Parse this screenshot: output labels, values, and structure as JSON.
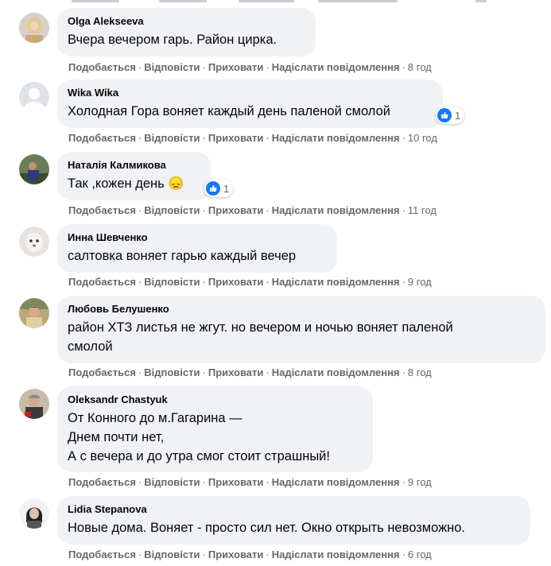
{
  "actions": {
    "like": "Подобається",
    "reply": "Відповісти",
    "hide": "Приховати",
    "message": "Надіслати повідомлення",
    "sep": "·"
  },
  "colors": {
    "bubble": "#f0f2f5",
    "action_text": "#65676b",
    "like_blue": "#1877f2"
  },
  "comments": [
    {
      "author": "Olga Alekseeva",
      "text": "Вчера вечером гарь. Район цирка.",
      "time": "8 год",
      "avatar": "photo-avatar"
    },
    {
      "author": "Wika Wika",
      "text": "Холодная Гора воняет каждый день паленой смолой",
      "time": "10 год",
      "avatar": "default-avatar",
      "reaction_count": "1",
      "reaction_icon": "like-icon"
    },
    {
      "author": "Наталія Калмикова",
      "text": "Так ,кожен день",
      "emoji": "😞",
      "time": "11 год",
      "avatar": "photo-avatar",
      "reaction_count": "1",
      "reaction_icon": "like-icon"
    },
    {
      "author": "Инна Шевченко",
      "text": "салтовка воняет гарью каждый вечер",
      "time": "9 год",
      "avatar": "photo-avatar"
    },
    {
      "author": "Любовь Белушенко",
      "text_lines": [
        "район ХТЗ листья не жгут. но вечером и ночью воняет паленой",
        "смолой"
      ],
      "time": "8 год",
      "avatar": "photo-avatar"
    },
    {
      "author": "Oleksandr Chastyuk",
      "text_lines": [
        "От Конного до м.Гагарина —",
        "Днем почти нет,",
        "А с вечера и до утра смог стоит страшный!"
      ],
      "time": "9 год",
      "avatar": "photo-avatar"
    },
    {
      "author": "Lidia Stepanova",
      "text": "Новые дома. Воняет - просто сил нет. Окно открыть невозможно.",
      "time": "6 год",
      "avatar": "photo-avatar"
    }
  ]
}
